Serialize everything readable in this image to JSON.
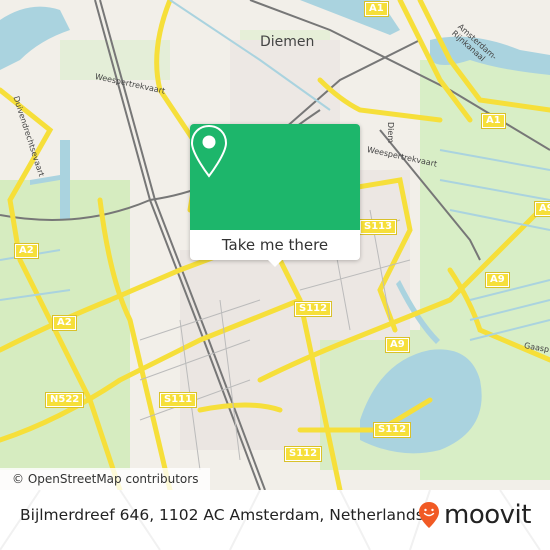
{
  "map": {
    "place_label": "Diemen",
    "water_labels": [
      "Amsterdam-Rijnkanaal",
      "Weespertrekvaart",
      "Duivendrechtsevaart",
      "Diem",
      "Weespertrekvaart",
      "Gaasp"
    ],
    "road_shields": [
      "A1",
      "A1",
      "A2",
      "A2",
      "N522",
      "S111",
      "S112",
      "S112",
      "S112",
      "S113",
      "A9",
      "A9",
      "A9"
    ],
    "attribution": "© OpenStreetMap contributors",
    "colors": {
      "land": "#f2efe9",
      "water": "#aad3df",
      "green": "#cdebb0",
      "motorway": "#f6df3a",
      "rail": "#777777"
    }
  },
  "popup": {
    "icon": "map-pin-icon",
    "button_label": "Take me there",
    "accent": "#1db66b"
  },
  "footer": {
    "address": "Bijlmerdreef 646, 1102 AC Amsterdam, Netherlands",
    "brand": "moovit",
    "brand_icon": "moovit-smiley-pin-icon",
    "brand_color": "#f15a24"
  }
}
